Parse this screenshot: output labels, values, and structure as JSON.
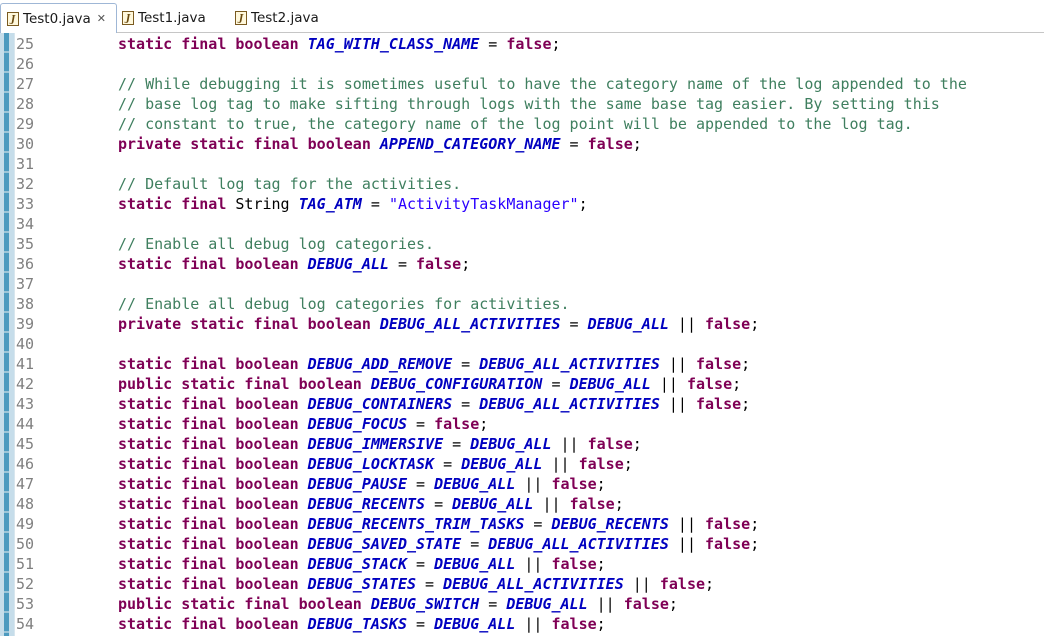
{
  "tabs": [
    {
      "label": "Test0.java",
      "active": true,
      "close": "✕"
    },
    {
      "label": "Test1.java",
      "active": false
    },
    {
      "label": "Test2.java",
      "active": false
    }
  ],
  "icon_letter": "J",
  "lines": [
    {
      "n": "25",
      "t": [
        [
          "kw",
          "static final boolean "
        ],
        [
          "cst",
          "TAG_WITH_CLASS_NAME"
        ],
        [
          "op",
          " = "
        ],
        [
          "kw",
          "false"
        ],
        [
          "op",
          ";"
        ]
      ]
    },
    {
      "n": "26",
      "t": []
    },
    {
      "n": "27",
      "t": [
        [
          "cm",
          "// While debugging it is sometimes useful to have the category name of the log appended to the"
        ]
      ]
    },
    {
      "n": "28",
      "t": [
        [
          "cm",
          "// base log tag to make sifting through logs with the same base tag easier. By setting this"
        ]
      ]
    },
    {
      "n": "29",
      "t": [
        [
          "cm",
          "// constant to true, the category name of the log point will be appended to the log tag."
        ]
      ]
    },
    {
      "n": "30",
      "t": [
        [
          "kw",
          "private static final boolean "
        ],
        [
          "cst",
          "APPEND_CATEGORY_NAME"
        ],
        [
          "op",
          " = "
        ],
        [
          "kw",
          "false"
        ],
        [
          "op",
          ";"
        ]
      ]
    },
    {
      "n": "31",
      "t": []
    },
    {
      "n": "32",
      "t": [
        [
          "cm",
          "// Default log tag for the activities."
        ]
      ]
    },
    {
      "n": "33",
      "t": [
        [
          "kw",
          "static final "
        ],
        [
          "op",
          "String "
        ],
        [
          "cst",
          "TAG_ATM"
        ],
        [
          "op",
          " = "
        ],
        [
          "str",
          "\"ActivityTaskManager\""
        ],
        [
          "op",
          ";"
        ]
      ]
    },
    {
      "n": "34",
      "t": []
    },
    {
      "n": "35",
      "t": [
        [
          "cm",
          "// Enable all debug log categories."
        ]
      ]
    },
    {
      "n": "36",
      "t": [
        [
          "kw",
          "static final boolean "
        ],
        [
          "cst",
          "DEBUG_ALL"
        ],
        [
          "op",
          " = "
        ],
        [
          "kw",
          "false"
        ],
        [
          "op",
          ";"
        ]
      ]
    },
    {
      "n": "37",
      "t": []
    },
    {
      "n": "38",
      "t": [
        [
          "cm",
          "// Enable all debug log categories for activities."
        ]
      ]
    },
    {
      "n": "39",
      "t": [
        [
          "kw",
          "private static final boolean "
        ],
        [
          "cst",
          "DEBUG_ALL_ACTIVITIES"
        ],
        [
          "op",
          " = "
        ],
        [
          "cst",
          "DEBUG_ALL"
        ],
        [
          "op",
          " || "
        ],
        [
          "kw",
          "false"
        ],
        [
          "op",
          ";"
        ]
      ]
    },
    {
      "n": "40",
      "t": []
    },
    {
      "n": "41",
      "t": [
        [
          "kw",
          "static final boolean "
        ],
        [
          "cst",
          "DEBUG_ADD_REMOVE"
        ],
        [
          "op",
          " = "
        ],
        [
          "cst",
          "DEBUG_ALL_ACTIVITIES"
        ],
        [
          "op",
          " || "
        ],
        [
          "kw",
          "false"
        ],
        [
          "op",
          ";"
        ]
      ]
    },
    {
      "n": "42",
      "t": [
        [
          "kw",
          "public static final boolean "
        ],
        [
          "cst",
          "DEBUG_CONFIGURATION"
        ],
        [
          "op",
          " = "
        ],
        [
          "cst",
          "DEBUG_ALL"
        ],
        [
          "op",
          " || "
        ],
        [
          "kw",
          "false"
        ],
        [
          "op",
          ";"
        ]
      ]
    },
    {
      "n": "43",
      "t": [
        [
          "kw",
          "static final boolean "
        ],
        [
          "cst",
          "DEBUG_CONTAINERS"
        ],
        [
          "op",
          " = "
        ],
        [
          "cst",
          "DEBUG_ALL_ACTIVITIES"
        ],
        [
          "op",
          " || "
        ],
        [
          "kw",
          "false"
        ],
        [
          "op",
          ";"
        ]
      ]
    },
    {
      "n": "44",
      "t": [
        [
          "kw",
          "static final boolean "
        ],
        [
          "cst",
          "DEBUG_FOCUS"
        ],
        [
          "op",
          " = "
        ],
        [
          "kw",
          "false"
        ],
        [
          "op",
          ";"
        ]
      ]
    },
    {
      "n": "45",
      "t": [
        [
          "kw",
          "static final boolean "
        ],
        [
          "cst",
          "DEBUG_IMMERSIVE"
        ],
        [
          "op",
          " = "
        ],
        [
          "cst",
          "DEBUG_ALL"
        ],
        [
          "op",
          " || "
        ],
        [
          "kw",
          "false"
        ],
        [
          "op",
          ";"
        ]
      ]
    },
    {
      "n": "46",
      "t": [
        [
          "kw",
          "static final boolean "
        ],
        [
          "cst",
          "DEBUG_LOCKTASK"
        ],
        [
          "op",
          " = "
        ],
        [
          "cst",
          "DEBUG_ALL"
        ],
        [
          "op",
          " || "
        ],
        [
          "kw",
          "false"
        ],
        [
          "op",
          ";"
        ]
      ]
    },
    {
      "n": "47",
      "t": [
        [
          "kw",
          "static final boolean "
        ],
        [
          "cst",
          "DEBUG_PAUSE"
        ],
        [
          "op",
          " = "
        ],
        [
          "cst",
          "DEBUG_ALL"
        ],
        [
          "op",
          " || "
        ],
        [
          "kw",
          "false"
        ],
        [
          "op",
          ";"
        ]
      ]
    },
    {
      "n": "48",
      "t": [
        [
          "kw",
          "static final boolean "
        ],
        [
          "cst",
          "DEBUG_RECENTS"
        ],
        [
          "op",
          " = "
        ],
        [
          "cst",
          "DEBUG_ALL"
        ],
        [
          "op",
          " || "
        ],
        [
          "kw",
          "false"
        ],
        [
          "op",
          ";"
        ]
      ]
    },
    {
      "n": "49",
      "t": [
        [
          "kw",
          "static final boolean "
        ],
        [
          "cst",
          "DEBUG_RECENTS_TRIM_TASKS"
        ],
        [
          "op",
          " = "
        ],
        [
          "cst",
          "DEBUG_RECENTS"
        ],
        [
          "op",
          " || "
        ],
        [
          "kw",
          "false"
        ],
        [
          "op",
          ";"
        ]
      ]
    },
    {
      "n": "50",
      "t": [
        [
          "kw",
          "static final boolean "
        ],
        [
          "cst",
          "DEBUG_SAVED_STATE"
        ],
        [
          "op",
          " = "
        ],
        [
          "cst",
          "DEBUG_ALL_ACTIVITIES"
        ],
        [
          "op",
          " || "
        ],
        [
          "kw",
          "false"
        ],
        [
          "op",
          ";"
        ]
      ]
    },
    {
      "n": "51",
      "t": [
        [
          "kw",
          "static final boolean "
        ],
        [
          "cst",
          "DEBUG_STACK"
        ],
        [
          "op",
          " = "
        ],
        [
          "cst",
          "DEBUG_ALL"
        ],
        [
          "op",
          " || "
        ],
        [
          "kw",
          "false"
        ],
        [
          "op",
          ";"
        ]
      ]
    },
    {
      "n": "52",
      "t": [
        [
          "kw",
          "static final boolean "
        ],
        [
          "cst",
          "DEBUG_STATES"
        ],
        [
          "op",
          " = "
        ],
        [
          "cst",
          "DEBUG_ALL_ACTIVITIES"
        ],
        [
          "op",
          " || "
        ],
        [
          "kw",
          "false"
        ],
        [
          "op",
          ";"
        ]
      ]
    },
    {
      "n": "53",
      "t": [
        [
          "kw",
          "public static final boolean "
        ],
        [
          "cst",
          "DEBUG_SWITCH"
        ],
        [
          "op",
          " = "
        ],
        [
          "cst",
          "DEBUG_ALL"
        ],
        [
          "op",
          " || "
        ],
        [
          "kw",
          "false"
        ],
        [
          "op",
          ";"
        ]
      ]
    },
    {
      "n": "54",
      "t": [
        [
          "kw",
          "static final boolean "
        ],
        [
          "cst",
          "DEBUG_TASKS"
        ],
        [
          "op",
          " = "
        ],
        [
          "cst",
          "DEBUG_ALL"
        ],
        [
          "op",
          " || "
        ],
        [
          "kw",
          "false"
        ],
        [
          "op",
          ";"
        ]
      ]
    }
  ]
}
